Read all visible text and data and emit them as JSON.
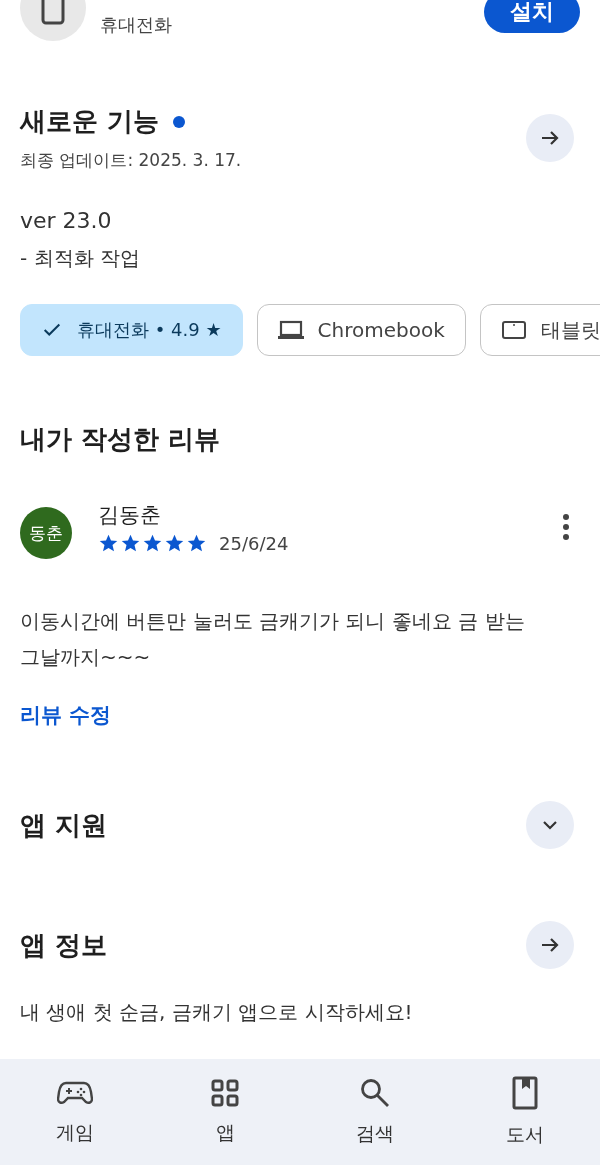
{
  "app_header": {
    "device_label": "휴대전화",
    "install_button": "설치"
  },
  "whats_new": {
    "title": "새로운 기능",
    "new_indicator": true,
    "updated": "최종 업데이트: 2025. 3. 17.",
    "version": "ver 23.0",
    "notes": "- 최적화 작업"
  },
  "device_chips": [
    {
      "label": "휴대전화 • 4.9 ★",
      "selected": true
    },
    {
      "kind": "laptop",
      "label": "Chromebook",
      "selected": false
    },
    {
      "kind": "tablet",
      "label": "태블릿",
      "selected": false
    }
  ],
  "my_review": {
    "title": "내가 작성한 리뷰",
    "avatar_initials": "동춘",
    "author": "김동춘",
    "stars": 5,
    "date": "25/6/24",
    "text": "이동시간에 버튼만 눌러도 금캐기가 되니 좋네요 금 받는 그날까지~~~",
    "edit_link": "리뷰 수정"
  },
  "sections": [
    {
      "kind": "expand",
      "title": "앱 지원"
    },
    {
      "kind": "arrow",
      "title": "앱 정보",
      "description": "내 생애 첫 순금, 금캐기 앱으로 시작하세요!"
    }
  ],
  "bottom_nav": [
    {
      "kind": "games",
      "label": "게임"
    },
    {
      "kind": "apps",
      "label": "앱"
    },
    {
      "kind": "search",
      "label": "검색"
    },
    {
      "kind": "books",
      "label": "도서"
    }
  ]
}
